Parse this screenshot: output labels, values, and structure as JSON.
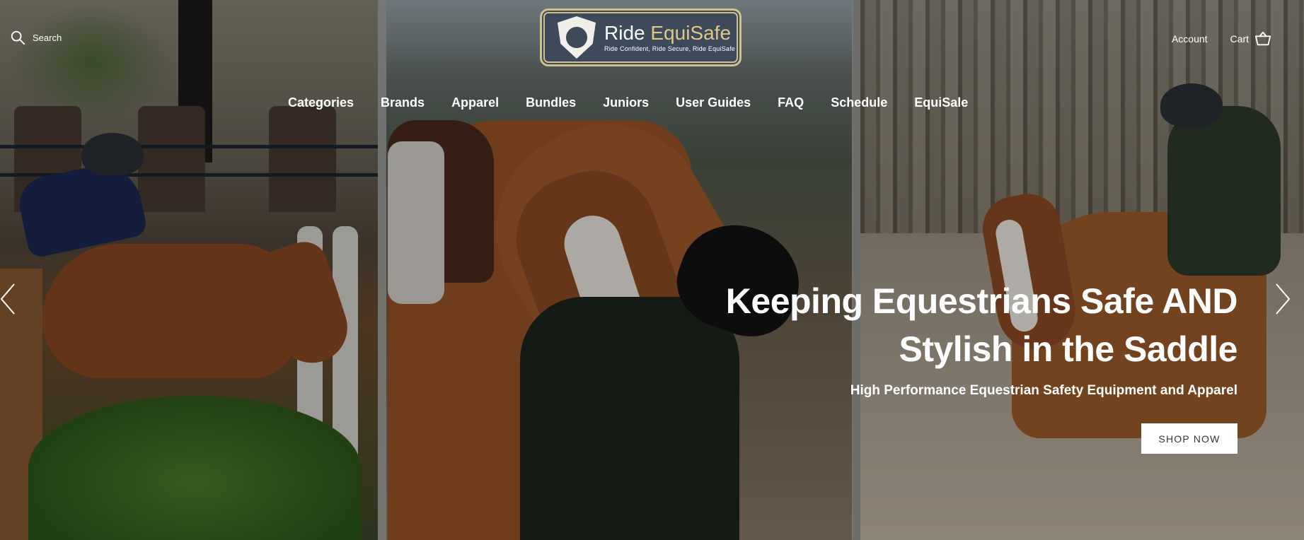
{
  "header": {
    "search_label": "Search",
    "logo": {
      "brand_part1": "Ride ",
      "brand_part2": "EquiSafe",
      "tagline": "Ride Confident, Ride Secure, Ride EquiSafe"
    },
    "account_label": "Account",
    "cart_label": "Cart"
  },
  "nav": {
    "items": [
      {
        "label": "Categories"
      },
      {
        "label": "Brands"
      },
      {
        "label": "Apparel"
      },
      {
        "label": "Bundles"
      },
      {
        "label": "Juniors"
      },
      {
        "label": "User Guides"
      },
      {
        "label": "FAQ"
      },
      {
        "label": "Schedule"
      },
      {
        "label": "EquiSale"
      }
    ]
  },
  "hero": {
    "headline_line1": "Keeping Equestrians Safe AND",
    "headline_line2": "Stylish in the Saddle",
    "subheadline": "High Performance Equestrian Safety Equipment and Apparel",
    "cta_label": "SHOP NOW"
  },
  "colors": {
    "logo_background": "#3c4a5c",
    "logo_border": "#d2c08b",
    "logo_accent": "#e0c884"
  },
  "icons": [
    "search-icon",
    "cart-icon",
    "shield-logo-icon",
    "chevron-left-icon",
    "chevron-right-icon"
  ]
}
